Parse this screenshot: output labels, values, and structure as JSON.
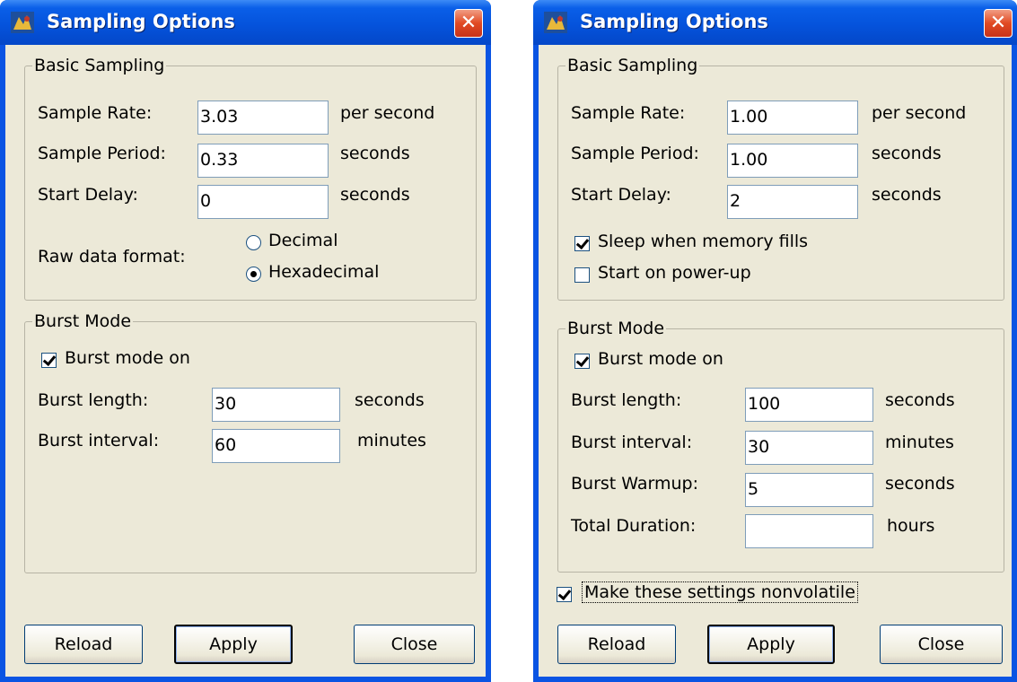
{
  "left": {
    "title": "Sampling Options",
    "basic": {
      "legend": "Basic Sampling",
      "sample_rate_label": "Sample Rate:",
      "sample_rate_value": "3.03",
      "sample_rate_unit": "per second",
      "sample_period_label": "Sample Period:",
      "sample_period_value": "0.33",
      "sample_period_unit": "seconds",
      "start_delay_label": "Start Delay:",
      "start_delay_value": "0",
      "start_delay_unit": "seconds",
      "raw_format_label": "Raw data format:",
      "decimal_label": "Decimal",
      "hex_label": "Hexadecimal",
      "selected_format": "Hexadecimal"
    },
    "burst": {
      "legend": "Burst Mode",
      "burst_on_label": "Burst mode on",
      "burst_on_checked": true,
      "length_label": "Burst length:",
      "length_value": "30",
      "length_unit": "seconds",
      "interval_label": "Burst interval:",
      "interval_value": "60",
      "interval_unit": "minutes"
    },
    "buttons": {
      "reload": "Reload",
      "apply": "Apply",
      "close": "Close"
    }
  },
  "right": {
    "title": "Sampling Options",
    "basic": {
      "legend": "Basic Sampling",
      "sample_rate_label": "Sample Rate:",
      "sample_rate_value": "1.00",
      "sample_rate_unit": "per second",
      "sample_period_label": "Sample Period:",
      "sample_period_value": "1.00",
      "sample_period_unit": "seconds",
      "start_delay_label": "Start Delay:",
      "start_delay_value": "2",
      "start_delay_unit": "seconds",
      "sleep_label": "Sleep when memory fills",
      "sleep_checked": true,
      "powerup_label": "Start on power-up",
      "powerup_checked": false
    },
    "burst": {
      "legend": "Burst Mode",
      "burst_on_label": "Burst mode on",
      "burst_on_checked": true,
      "length_label": "Burst length:",
      "length_value": "100",
      "length_unit": "seconds",
      "interval_label": "Burst interval:",
      "interval_value": "30",
      "interval_unit": "minutes",
      "warmup_label": "Burst Warmup:",
      "warmup_value": "5",
      "warmup_unit": "seconds",
      "duration_label": "Total Duration:",
      "duration_value": "",
      "duration_unit": "hours"
    },
    "nonvolatile_label": "Make these settings nonvolatile",
    "nonvolatile_checked": true,
    "buttons": {
      "reload": "Reload",
      "apply": "Apply",
      "close": "Close"
    }
  },
  "colors": {
    "titlebar": "#0553dc",
    "client": "#ece9d8",
    "close": "#e14a23"
  },
  "icons": {
    "app": "app-icon",
    "close": "close-x-icon"
  }
}
